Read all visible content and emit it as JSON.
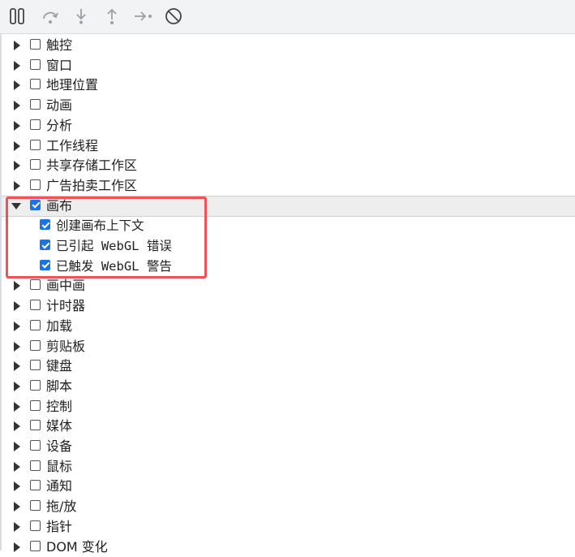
{
  "toolbar": {
    "buttons": [
      {
        "name": "pause-icon"
      },
      {
        "name": "step-over-icon"
      },
      {
        "name": "step-into-icon"
      },
      {
        "name": "step-out-icon"
      },
      {
        "name": "step-icon"
      },
      {
        "name": "deactivate-breakpoints-icon"
      }
    ]
  },
  "categories": [
    {
      "label": "触控",
      "checked": false,
      "expanded": false
    },
    {
      "label": "窗口",
      "checked": false,
      "expanded": false
    },
    {
      "label": "地理位置",
      "checked": false,
      "expanded": false
    },
    {
      "label": "动画",
      "checked": false,
      "expanded": false
    },
    {
      "label": "分析",
      "checked": false,
      "expanded": false
    },
    {
      "label": "工作线程",
      "checked": false,
      "expanded": false
    },
    {
      "label": "共享存储工作区",
      "checked": false,
      "expanded": false
    },
    {
      "label": "广告拍卖工作区",
      "checked": false,
      "expanded": false
    },
    {
      "label": "画布",
      "checked": true,
      "expanded": true,
      "children": [
        {
          "label": "创建画布上下文",
          "checked": true
        },
        {
          "label": "已引起 WebGL 错误",
          "checked": true
        },
        {
          "label": "已触发 WebGL 警告",
          "checked": true
        }
      ]
    },
    {
      "label": "画中画",
      "checked": false,
      "expanded": false
    },
    {
      "label": "计时器",
      "checked": false,
      "expanded": false
    },
    {
      "label": "加载",
      "checked": false,
      "expanded": false
    },
    {
      "label": "剪贴板",
      "checked": false,
      "expanded": false
    },
    {
      "label": "键盘",
      "checked": false,
      "expanded": false
    },
    {
      "label": "脚本",
      "checked": false,
      "expanded": false
    },
    {
      "label": "控制",
      "checked": false,
      "expanded": false
    },
    {
      "label": "媒体",
      "checked": false,
      "expanded": false
    },
    {
      "label": "设备",
      "checked": false,
      "expanded": false
    },
    {
      "label": "鼠标",
      "checked": false,
      "expanded": false
    },
    {
      "label": "通知",
      "checked": false,
      "expanded": false
    },
    {
      "label": "拖/放",
      "checked": false,
      "expanded": false
    },
    {
      "label": "指针",
      "checked": false,
      "expanded": false
    },
    {
      "label": "DOM 变化",
      "checked": false,
      "expanded": false
    }
  ],
  "colors": {
    "highlight": "#f0525b",
    "checkbox_checked": "#1a73e8"
  }
}
